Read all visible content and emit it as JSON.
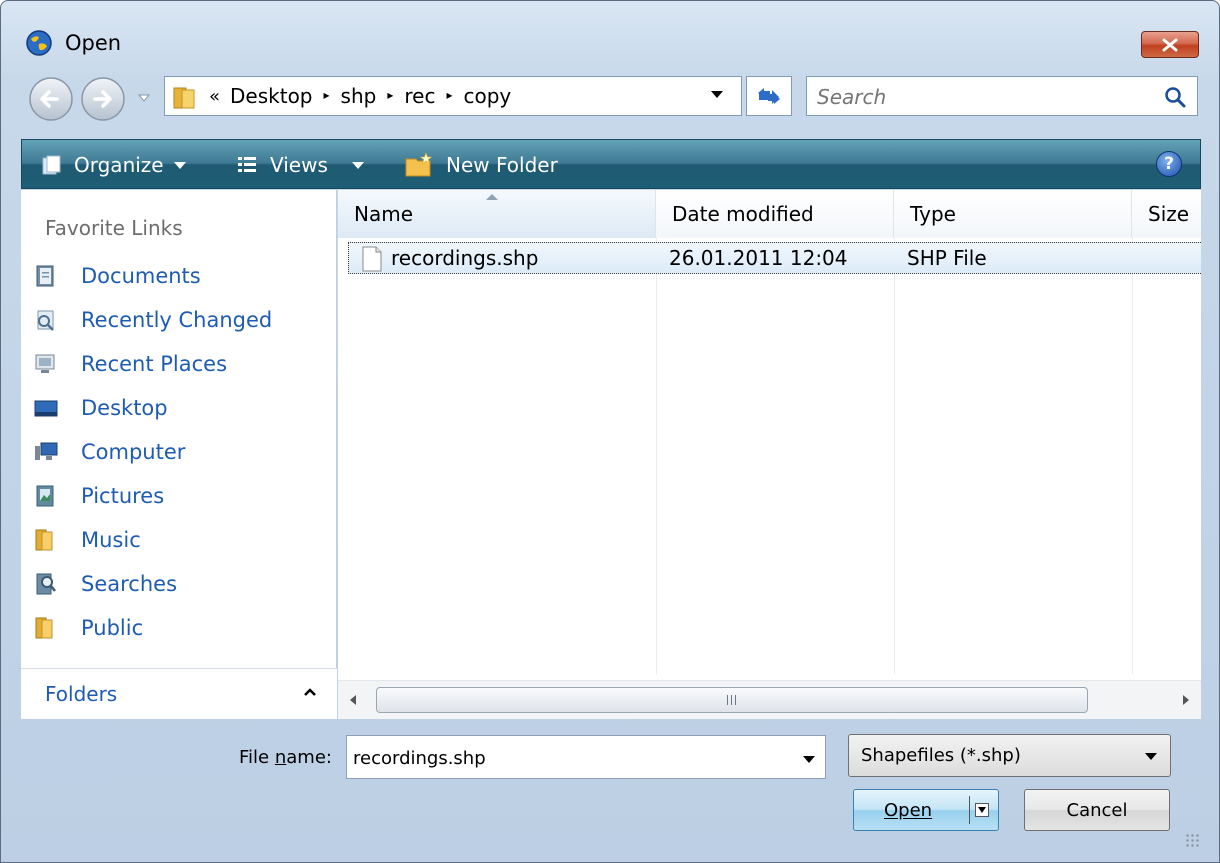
{
  "window": {
    "title": "Open",
    "icon": "globe-app-icon",
    "close_icon": "close-x-icon"
  },
  "address": {
    "overflow_marker": "«",
    "crumbs": [
      "Desktop",
      "shp",
      "rec",
      "copy"
    ],
    "separator": "▸"
  },
  "search": {
    "placeholder": "Search"
  },
  "toolbar": {
    "organize_label": "Organize",
    "views_label": "Views",
    "new_folder_label": "New Folder",
    "help_glyph": "?"
  },
  "sidebar": {
    "header": "Favorite Links",
    "items": [
      {
        "label": "Documents",
        "icon": "documents-icon"
      },
      {
        "label": "Recently Changed",
        "icon": "recently-changed-icon"
      },
      {
        "label": "Recent Places",
        "icon": "recent-places-icon"
      },
      {
        "label": "Desktop",
        "icon": "desktop-icon"
      },
      {
        "label": "Computer",
        "icon": "computer-icon"
      },
      {
        "label": "Pictures",
        "icon": "pictures-icon"
      },
      {
        "label": "Music",
        "icon": "music-folder-icon"
      },
      {
        "label": "Searches",
        "icon": "searches-icon"
      },
      {
        "label": "Public",
        "icon": "public-folder-icon"
      }
    ],
    "folders_label": "Folders"
  },
  "file_list": {
    "columns": [
      "Name",
      "Date modified",
      "Type",
      "Size"
    ],
    "rows": [
      {
        "name": "recordings.shp",
        "date": "26.01.2011 12:04",
        "type": "SHP File",
        "size": ""
      }
    ],
    "scroll_grip": "III"
  },
  "footer": {
    "file_name_label_pre": "File ",
    "file_name_label_mnemonic": "n",
    "file_name_label_post": "ame:",
    "file_name_value": "recordings.shp",
    "filter_value": "Shapefiles (*.shp)",
    "open_label": "Open",
    "cancel_label": "Cancel"
  },
  "colors": {
    "toolbar": "#1f5a72",
    "link_blue": "#1e5cb3",
    "close_red": "#c0401f",
    "selection": "#dcebf8"
  }
}
